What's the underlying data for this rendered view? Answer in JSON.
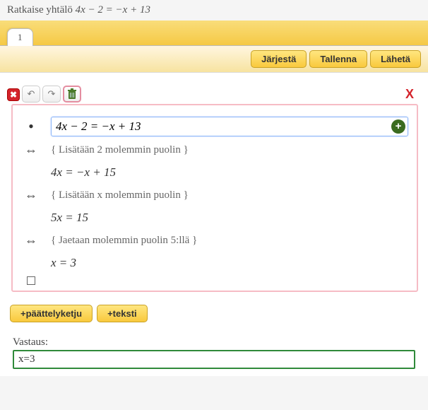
{
  "header": {
    "prompt_prefix": "Ratkaise yhtälö ",
    "equation": "4x − 2 =  −x + 13"
  },
  "tabs": [
    {
      "label": "1"
    }
  ],
  "buttons": {
    "sort": "Järjestä",
    "save": "Tallenna",
    "send": "Lähetä",
    "add_chain": "+päättelyketju",
    "add_text": "+teksti"
  },
  "derivation": {
    "input_equation": "4x − 2 =  −x + 13",
    "steps": [
      {
        "marker": "⇔",
        "comment": "{ Lisätään 2 molemmin puolin }"
      },
      {
        "marker": "",
        "expr": "4x =  −x + 15"
      },
      {
        "marker": "⇔",
        "comment": "{ Lisätään x molemmin puolin }"
      },
      {
        "marker": "",
        "expr": "5x = 15"
      },
      {
        "marker": "⇔",
        "comment": "{ Jaetaan molemmin puolin 5:llä }"
      },
      {
        "marker": "",
        "expr": "x = 3"
      }
    ]
  },
  "answer": {
    "label": "Vastaus:",
    "value": "x=3"
  },
  "icons": {
    "close_small": "✖",
    "undo": "↶",
    "redo": "↷",
    "close_x": "X",
    "plus": "+",
    "iff": "⇔",
    "bullet": "•"
  }
}
